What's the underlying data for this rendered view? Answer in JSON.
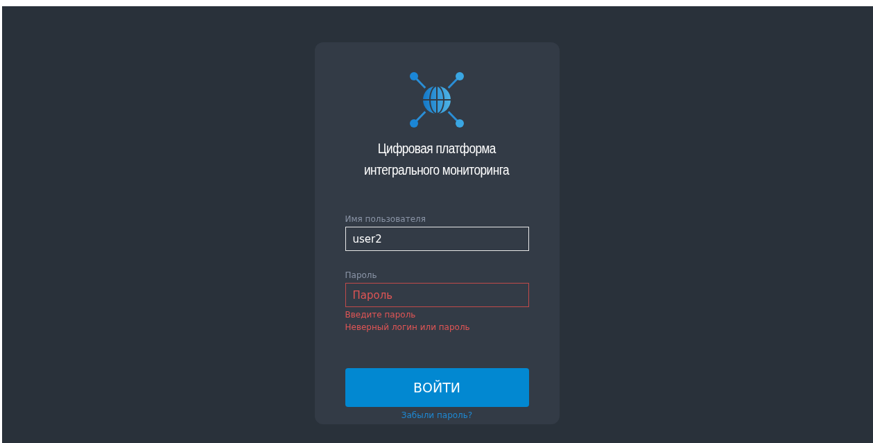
{
  "title_lines": [
    "Цифровая платформа",
    "интегрального мониторинга"
  ],
  "fields": [
    {
      "label": "Имя пользователя",
      "value": "user2",
      "error": false
    },
    {
      "label": "Пароль",
      "placeholder": "Пароль",
      "error": true
    }
  ],
  "errors": [
    "Введите пароль",
    "Неверный логин или пароль"
  ],
  "submit_button": "ВОЙТИ",
  "forgot_link": "Забыли пароль?"
}
